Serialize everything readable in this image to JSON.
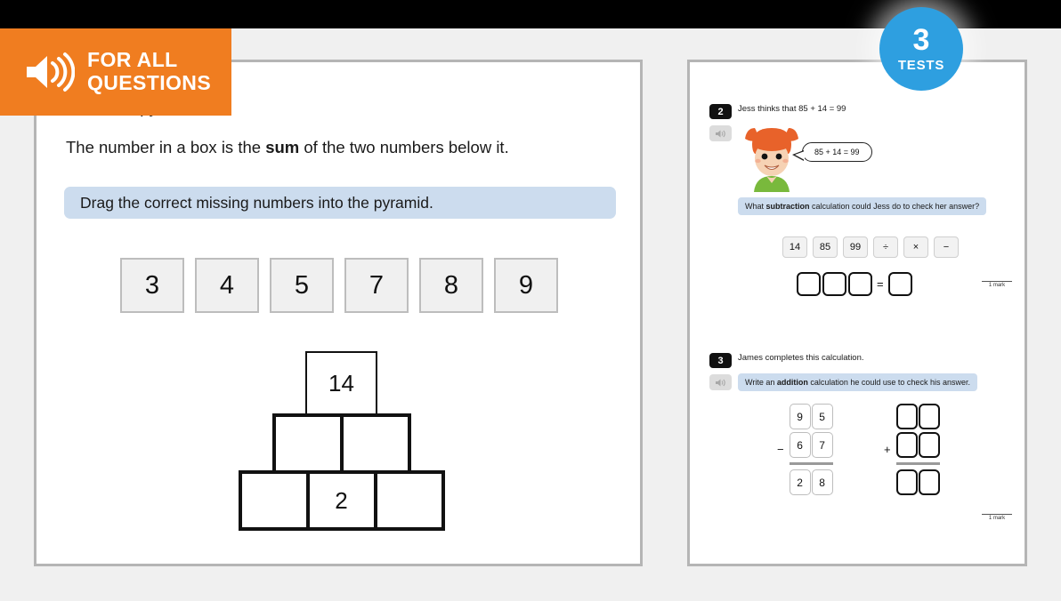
{
  "banner": {
    "icon": "speaker-icon",
    "line1": "FOR ALL",
    "line2": "QUESTIONS"
  },
  "tests_badge": {
    "count": "3",
    "label": "TESTS",
    "color": "#2e9fe0"
  },
  "left_panel": {
    "line1": "a number pyramid.",
    "line2_prefix": "The number in a box is the ",
    "line2_bold": "sum",
    "line2_suffix": " of the two numbers below it.",
    "drag_instruction": "Drag the correct missing numbers into the pyramid.",
    "number_tiles": [
      "3",
      "4",
      "5",
      "7",
      "8",
      "9"
    ],
    "pyramid": {
      "top": [
        "14"
      ],
      "middle": [
        "",
        ""
      ],
      "bottom": [
        "",
        "2",
        ""
      ]
    }
  },
  "right_panel": {
    "question2": {
      "number": "2",
      "speaker_icon": "speaker-icon",
      "stem": "Jess thinks that 85 + 14 = 99",
      "speech_bubble": "85 + 14 = 99",
      "prompt_prefix": "What ",
      "prompt_bold": "subtraction",
      "prompt_suffix": " calculation could Jess do to check her answer?",
      "chips": [
        "14",
        "85",
        "99",
        "÷",
        "×",
        "−"
      ],
      "answer_boxes": [
        "",
        "",
        ""
      ],
      "equals": "=",
      "result_box": "",
      "mark": "1 mark"
    },
    "question3": {
      "number": "3",
      "speaker_icon": "speaker-icon",
      "stem": "James completes this calculation.",
      "prompt_prefix": "Write an ",
      "prompt_bold": "addition",
      "prompt_suffix": " calculation he could use to check his answer.",
      "given_calc": {
        "operator": "−",
        "row1": [
          "9",
          "5"
        ],
        "row2": [
          "6",
          "7"
        ],
        "row3": [
          "2",
          "8"
        ]
      },
      "answer_calc": {
        "operator": "+",
        "row1": [
          "",
          ""
        ],
        "row2": [
          "",
          ""
        ],
        "row3": [
          "",
          ""
        ]
      },
      "mark": "1 mark"
    }
  }
}
